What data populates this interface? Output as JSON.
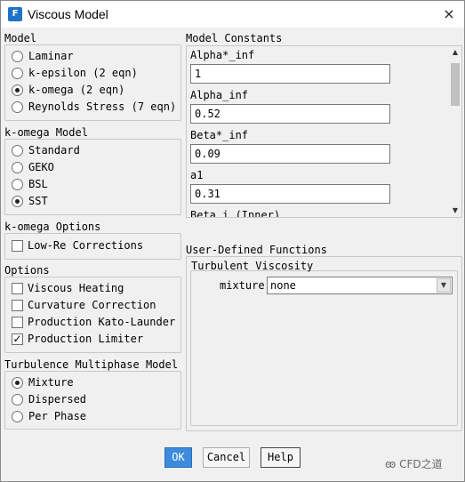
{
  "window": {
    "app_icon": "F",
    "title": "Viscous Model",
    "close_icon": "×"
  },
  "model": {
    "label": "Model",
    "options": [
      {
        "label": "Laminar",
        "selected": false
      },
      {
        "label": "k-epsilon (2 eqn)",
        "selected": false
      },
      {
        "label": "k-omega (2 eqn)",
        "selected": true
      },
      {
        "label": "Reynolds Stress (7 eqn)",
        "selected": false
      }
    ]
  },
  "komega_model": {
    "label": "k-omega Model",
    "options": [
      {
        "label": "Standard",
        "selected": false
      },
      {
        "label": "GEKO",
        "selected": false
      },
      {
        "label": "BSL",
        "selected": false
      },
      {
        "label": "SST",
        "selected": true
      }
    ]
  },
  "komega_options": {
    "label": "k-omega Options",
    "items": [
      {
        "label": "Low-Re Corrections",
        "checked": false
      }
    ]
  },
  "options": {
    "label": "Options",
    "items": [
      {
        "label": "Viscous Heating",
        "checked": false
      },
      {
        "label": "Curvature Correction",
        "checked": false
      },
      {
        "label": "Production Kato-Launder",
        "checked": false
      },
      {
        "label": "Production Limiter",
        "checked": true
      }
    ],
    "check_mark": "✓"
  },
  "multiphase": {
    "label": "Turbulence Multiphase Model",
    "options": [
      {
        "label": "Mixture",
        "selected": true
      },
      {
        "label": "Dispersed",
        "selected": false
      },
      {
        "label": "Per Phase",
        "selected": false
      }
    ]
  },
  "constants": {
    "label": "Model Constants",
    "items": [
      {
        "name": "Alpha*_inf",
        "value": "1"
      },
      {
        "name": "Alpha_inf",
        "value": "0.52"
      },
      {
        "name": "Beta*_inf",
        "value": "0.09"
      },
      {
        "name": "a1",
        "value": "0.31"
      },
      {
        "name": "Beta i (Inner)",
        "value": ""
      }
    ],
    "scroll_up": "▲",
    "scroll_down": "▼"
  },
  "udf": {
    "label": "User-Defined Functions",
    "sub_label": "Turbulent Viscosity",
    "field_label": "mixture",
    "value": "none",
    "dropdown_arrow": "▼"
  },
  "buttons": {
    "ok": "OK",
    "cancel": "Cancel",
    "help": "Help"
  },
  "watermark": "CFD之道"
}
